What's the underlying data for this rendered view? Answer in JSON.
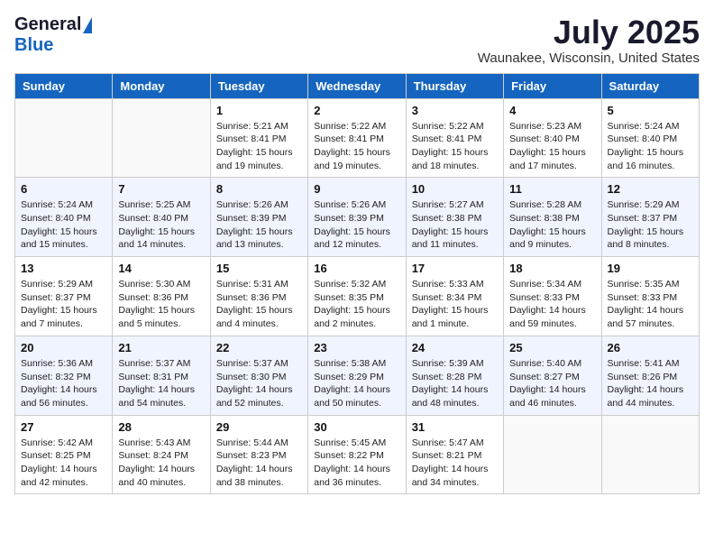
{
  "logo": {
    "general": "General",
    "blue": "Blue"
  },
  "title": "July 2025",
  "location": "Waunakee, Wisconsin, United States",
  "days_of_week": [
    "Sunday",
    "Monday",
    "Tuesday",
    "Wednesday",
    "Thursday",
    "Friday",
    "Saturday"
  ],
  "weeks": [
    [
      {
        "day": "",
        "info": ""
      },
      {
        "day": "",
        "info": ""
      },
      {
        "day": "1",
        "sunrise": "Sunrise: 5:21 AM",
        "sunset": "Sunset: 8:41 PM",
        "daylight": "Daylight: 15 hours and 19 minutes."
      },
      {
        "day": "2",
        "sunrise": "Sunrise: 5:22 AM",
        "sunset": "Sunset: 8:41 PM",
        "daylight": "Daylight: 15 hours and 19 minutes."
      },
      {
        "day": "3",
        "sunrise": "Sunrise: 5:22 AM",
        "sunset": "Sunset: 8:41 PM",
        "daylight": "Daylight: 15 hours and 18 minutes."
      },
      {
        "day": "4",
        "sunrise": "Sunrise: 5:23 AM",
        "sunset": "Sunset: 8:40 PM",
        "daylight": "Daylight: 15 hours and 17 minutes."
      },
      {
        "day": "5",
        "sunrise": "Sunrise: 5:24 AM",
        "sunset": "Sunset: 8:40 PM",
        "daylight": "Daylight: 15 hours and 16 minutes."
      }
    ],
    [
      {
        "day": "6",
        "sunrise": "Sunrise: 5:24 AM",
        "sunset": "Sunset: 8:40 PM",
        "daylight": "Daylight: 15 hours and 15 minutes."
      },
      {
        "day": "7",
        "sunrise": "Sunrise: 5:25 AM",
        "sunset": "Sunset: 8:40 PM",
        "daylight": "Daylight: 15 hours and 14 minutes."
      },
      {
        "day": "8",
        "sunrise": "Sunrise: 5:26 AM",
        "sunset": "Sunset: 8:39 PM",
        "daylight": "Daylight: 15 hours and 13 minutes."
      },
      {
        "day": "9",
        "sunrise": "Sunrise: 5:26 AM",
        "sunset": "Sunset: 8:39 PM",
        "daylight": "Daylight: 15 hours and 12 minutes."
      },
      {
        "day": "10",
        "sunrise": "Sunrise: 5:27 AM",
        "sunset": "Sunset: 8:38 PM",
        "daylight": "Daylight: 15 hours and 11 minutes."
      },
      {
        "day": "11",
        "sunrise": "Sunrise: 5:28 AM",
        "sunset": "Sunset: 8:38 PM",
        "daylight": "Daylight: 15 hours and 9 minutes."
      },
      {
        "day": "12",
        "sunrise": "Sunrise: 5:29 AM",
        "sunset": "Sunset: 8:37 PM",
        "daylight": "Daylight: 15 hours and 8 minutes."
      }
    ],
    [
      {
        "day": "13",
        "sunrise": "Sunrise: 5:29 AM",
        "sunset": "Sunset: 8:37 PM",
        "daylight": "Daylight: 15 hours and 7 minutes."
      },
      {
        "day": "14",
        "sunrise": "Sunrise: 5:30 AM",
        "sunset": "Sunset: 8:36 PM",
        "daylight": "Daylight: 15 hours and 5 minutes."
      },
      {
        "day": "15",
        "sunrise": "Sunrise: 5:31 AM",
        "sunset": "Sunset: 8:36 PM",
        "daylight": "Daylight: 15 hours and 4 minutes."
      },
      {
        "day": "16",
        "sunrise": "Sunrise: 5:32 AM",
        "sunset": "Sunset: 8:35 PM",
        "daylight": "Daylight: 15 hours and 2 minutes."
      },
      {
        "day": "17",
        "sunrise": "Sunrise: 5:33 AM",
        "sunset": "Sunset: 8:34 PM",
        "daylight": "Daylight: 15 hours and 1 minute."
      },
      {
        "day": "18",
        "sunrise": "Sunrise: 5:34 AM",
        "sunset": "Sunset: 8:33 PM",
        "daylight": "Daylight: 14 hours and 59 minutes."
      },
      {
        "day": "19",
        "sunrise": "Sunrise: 5:35 AM",
        "sunset": "Sunset: 8:33 PM",
        "daylight": "Daylight: 14 hours and 57 minutes."
      }
    ],
    [
      {
        "day": "20",
        "sunrise": "Sunrise: 5:36 AM",
        "sunset": "Sunset: 8:32 PM",
        "daylight": "Daylight: 14 hours and 56 minutes."
      },
      {
        "day": "21",
        "sunrise": "Sunrise: 5:37 AM",
        "sunset": "Sunset: 8:31 PM",
        "daylight": "Daylight: 14 hours and 54 minutes."
      },
      {
        "day": "22",
        "sunrise": "Sunrise: 5:37 AM",
        "sunset": "Sunset: 8:30 PM",
        "daylight": "Daylight: 14 hours and 52 minutes."
      },
      {
        "day": "23",
        "sunrise": "Sunrise: 5:38 AM",
        "sunset": "Sunset: 8:29 PM",
        "daylight": "Daylight: 14 hours and 50 minutes."
      },
      {
        "day": "24",
        "sunrise": "Sunrise: 5:39 AM",
        "sunset": "Sunset: 8:28 PM",
        "daylight": "Daylight: 14 hours and 48 minutes."
      },
      {
        "day": "25",
        "sunrise": "Sunrise: 5:40 AM",
        "sunset": "Sunset: 8:27 PM",
        "daylight": "Daylight: 14 hours and 46 minutes."
      },
      {
        "day": "26",
        "sunrise": "Sunrise: 5:41 AM",
        "sunset": "Sunset: 8:26 PM",
        "daylight": "Daylight: 14 hours and 44 minutes."
      }
    ],
    [
      {
        "day": "27",
        "sunrise": "Sunrise: 5:42 AM",
        "sunset": "Sunset: 8:25 PM",
        "daylight": "Daylight: 14 hours and 42 minutes."
      },
      {
        "day": "28",
        "sunrise": "Sunrise: 5:43 AM",
        "sunset": "Sunset: 8:24 PM",
        "daylight": "Daylight: 14 hours and 40 minutes."
      },
      {
        "day": "29",
        "sunrise": "Sunrise: 5:44 AM",
        "sunset": "Sunset: 8:23 PM",
        "daylight": "Daylight: 14 hours and 38 minutes."
      },
      {
        "day": "30",
        "sunrise": "Sunrise: 5:45 AM",
        "sunset": "Sunset: 8:22 PM",
        "daylight": "Daylight: 14 hours and 36 minutes."
      },
      {
        "day": "31",
        "sunrise": "Sunrise: 5:47 AM",
        "sunset": "Sunset: 8:21 PM",
        "daylight": "Daylight: 14 hours and 34 minutes."
      },
      {
        "day": "",
        "info": ""
      },
      {
        "day": "",
        "info": ""
      }
    ]
  ]
}
